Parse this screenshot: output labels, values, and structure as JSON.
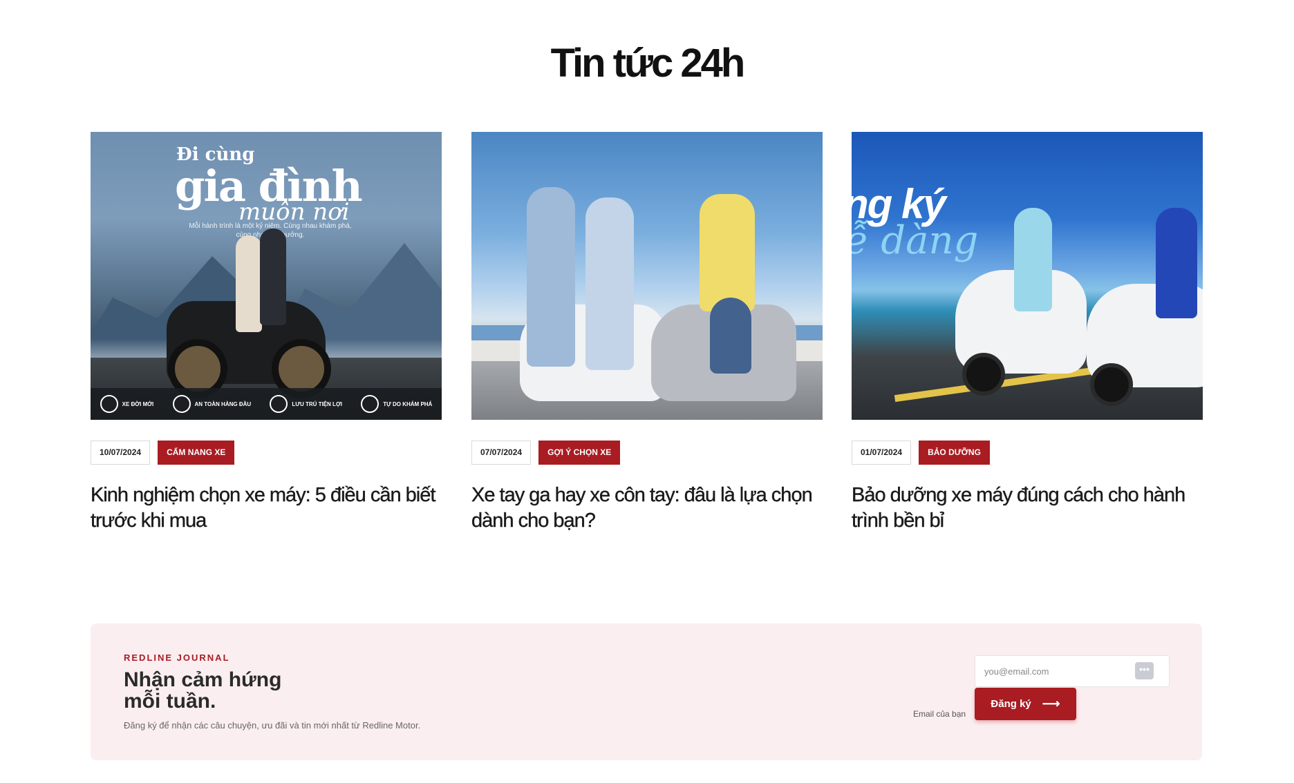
{
  "section": {
    "title": "Tin tức 24h"
  },
  "articles": [
    {
      "date": "10/07/2024",
      "category": "CẨM NANG XE",
      "title": "Kinh nghiệm chọn xe máy: 5 điều cần biết trước khi mua",
      "image": {
        "headline_1": "Đi cùng",
        "headline_2": "gia đình",
        "headline_3": "muôn nơi",
        "subtitle": "Mỗi hành trình là một kỷ niệm. Cùng nhau khám phá, cùng nhau tận hưởng.",
        "features": [
          "XE ĐỜI MỚI",
          "AN TOÀN HÀNG ĐẦU",
          "LƯU TRÚ TIỆN LỢI",
          "TỰ DO KHÁM PHÁ"
        ]
      }
    },
    {
      "date": "07/07/2024",
      "category": "GỢI Ý CHỌN XE",
      "title": "Xe tay ga hay xe côn tay: đâu là lựa chọn dành cho bạn?"
    },
    {
      "date": "01/07/2024",
      "category": "BẢO DƯỠNG",
      "title": "Bảo dưỡng xe máy đúng cách cho hành trình bền bỉ",
      "image": {
        "headline_1": "ng ký",
        "headline_2": "ễ dàng"
      }
    }
  ],
  "newsletter": {
    "kicker": "REDLINE JOURNAL",
    "title": "Nhận cảm hứng mỗi tuần.",
    "description": "Đăng ký để nhận các câu chuyện, ưu đãi và tin mới nhất từ Redline Motor.",
    "email_label": "Email của bạn",
    "email_placeholder": "you@email.com",
    "email_value": "",
    "button_label": "Đăng ký",
    "accent_color": "#a81c22",
    "background_color": "#fbeef0"
  }
}
